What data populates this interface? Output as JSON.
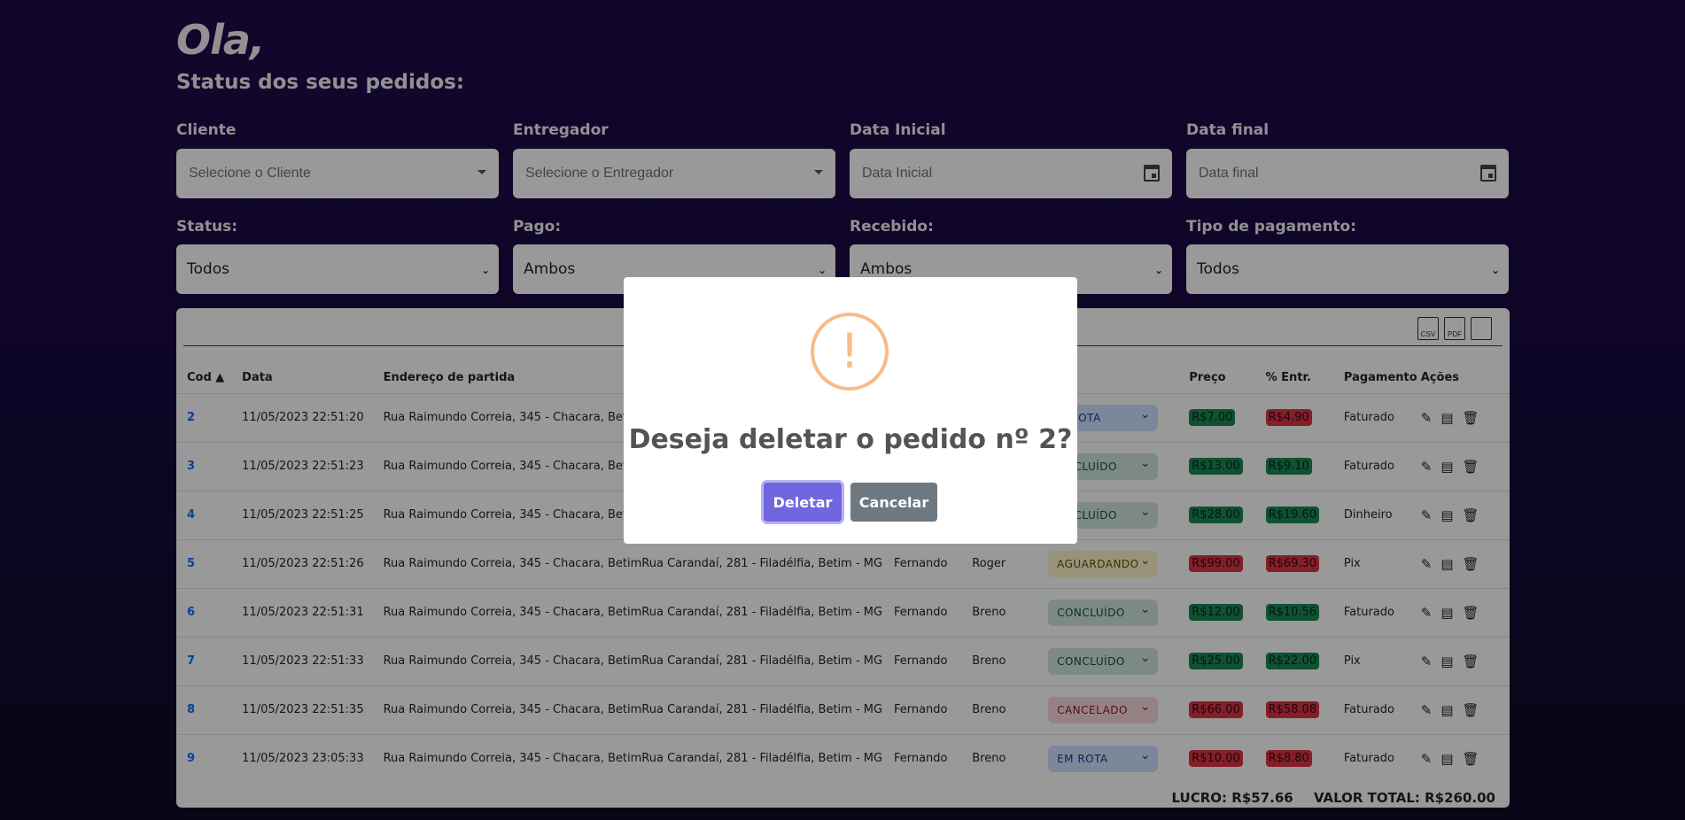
{
  "header": {
    "greeting": "Ola,",
    "subtitle": "Status dos seus pedidos:"
  },
  "filters": {
    "cliente": {
      "label": "Cliente",
      "placeholder": "Selecione o Cliente"
    },
    "entregador": {
      "label": "Entregador",
      "placeholder": "Selecione o Entregador"
    },
    "data_inicial": {
      "label": "Data Inicial",
      "placeholder": "Data Inicial"
    },
    "data_final": {
      "label": "Data final",
      "placeholder": "Data final"
    },
    "status": {
      "label": "Status:",
      "value": "Todos"
    },
    "pago": {
      "label": "Pago:",
      "value": "Ambos"
    },
    "recebido": {
      "label": "Recebido:",
      "value": "Ambos"
    },
    "tipo_pagamento": {
      "label": "Tipo de pagamento:",
      "value": "Todos"
    }
  },
  "toolbar": {
    "csv": "CSV",
    "pdf": "PDF"
  },
  "table": {
    "headers": [
      "Cod ▲",
      "Data",
      "Endereço de partida",
      "",
      "",
      "",
      "tus",
      "Preço",
      "% Entr.",
      "Pagamento",
      "Ações"
    ],
    "rows": [
      {
        "cod": "2",
        "data": "11/05/2023 22:51:20",
        "partida": "Rua Raimundo Correia, 345 - Chacara, Bet",
        "destino": "",
        "cliente": "",
        "entregador": "",
        "status": "M ROTA",
        "status_type": "rota",
        "preco": "R$7.00",
        "preco_type": "green",
        "entr": "R$4.90",
        "entr_type": "red",
        "pagamento": "Faturado"
      },
      {
        "cod": "3",
        "data": "11/05/2023 22:51:23",
        "partida": "Rua Raimundo Correia, 345 - Chacara, Bet",
        "destino": "",
        "cliente": "",
        "entregador": "",
        "status": "ONCLUÍDO",
        "status_type": "conc",
        "preco": "R$13.00",
        "preco_type": "green",
        "entr": "R$9.10",
        "entr_type": "green",
        "pagamento": "Faturado"
      },
      {
        "cod": "4",
        "data": "11/05/2023 22:51:25",
        "partida": "Rua Raimundo Correia, 345 - Chacara, Bet",
        "destino": "",
        "cliente": "",
        "entregador": "",
        "status": "ONCLUÍDO",
        "status_type": "conc",
        "preco": "R$28.00",
        "preco_type": "green",
        "entr": "R$19.60",
        "entr_type": "green",
        "pagamento": "Dinheiro"
      },
      {
        "cod": "5",
        "data": "11/05/2023 22:51:26",
        "partida": "Rua Raimundo Correia, 345 - Chacara, Betim",
        "destino": "Rua Carandaí, 281 - Filadélfia, Betim - MG",
        "cliente": "Fernando",
        "entregador": "Roger",
        "status": "AGUARDANDO",
        "status_type": "agua",
        "preco": "R$99.00",
        "preco_type": "red",
        "entr": "R$69.30",
        "entr_type": "red",
        "pagamento": "Pix"
      },
      {
        "cod": "6",
        "data": "11/05/2023 22:51:31",
        "partida": "Rua Raimundo Correia, 345 - Chacara, Betim",
        "destino": "Rua Carandaí, 281 - Filadélfia, Betim - MG",
        "cliente": "Fernando",
        "entregador": "Breno",
        "status": "CONCLUÍDO",
        "status_type": "conc",
        "preco": "R$12.00",
        "preco_type": "green",
        "entr": "R$10.56",
        "entr_type": "green",
        "pagamento": "Faturado"
      },
      {
        "cod": "7",
        "data": "11/05/2023 22:51:33",
        "partida": "Rua Raimundo Correia, 345 - Chacara, Betim",
        "destino": "Rua Carandaí, 281 - Filadélfia, Betim - MG",
        "cliente": "Fernando",
        "entregador": "Breno",
        "status": "CONCLUÍDO",
        "status_type": "conc",
        "preco": "R$25.00",
        "preco_type": "green",
        "entr": "R$22.00",
        "entr_type": "green",
        "pagamento": "Pix"
      },
      {
        "cod": "8",
        "data": "11/05/2023 22:51:35",
        "partida": "Rua Raimundo Correia, 345 - Chacara, Betim",
        "destino": "Rua Carandaí, 281 - Filadélfia, Betim - MG",
        "cliente": "Fernando",
        "entregador": "Breno",
        "status": "CANCELADO",
        "status_type": "canc",
        "preco": "R$66.00",
        "preco_type": "red",
        "entr": "R$58.08",
        "entr_type": "red",
        "pagamento": "Faturado"
      },
      {
        "cod": "9",
        "data": "11/05/2023 23:05:33",
        "partida": "Rua Raimundo Correia, 345 - Chacara, Betim",
        "destino": "Rua Carandaí, 281 - Filadélfia, Betim - MG",
        "cliente": "Fernando",
        "entregador": "Breno",
        "status": "EM ROTA",
        "status_type": "rota",
        "preco": "R$10.00",
        "preco_type": "red",
        "entr": "R$8.80",
        "entr_type": "red",
        "pagamento": "Faturado"
      }
    ]
  },
  "totals": {
    "lucro": "LUCRO: R$57.66",
    "valor_total": "VALOR TOTAL: R$260.00"
  },
  "modal": {
    "icon": "!",
    "message": "Deseja deletar o pedido nº 2?",
    "confirm_label": "Deletar",
    "cancel_label": "Cancelar"
  },
  "colors": {
    "confirm": "#7066e0",
    "cancel": "#6e7881",
    "warning": "#f8bb86",
    "link": "#0d6efd"
  }
}
